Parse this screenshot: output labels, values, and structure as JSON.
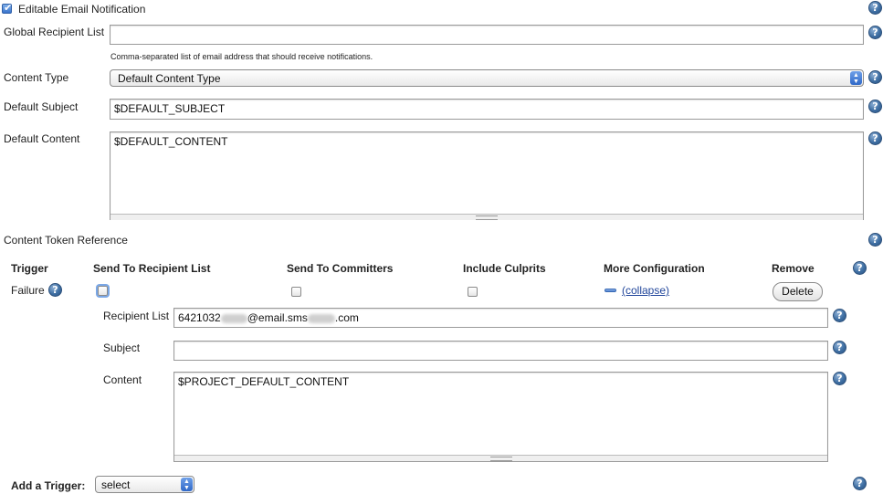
{
  "editable": {
    "checkbox_label": "Editable Email Notification",
    "checked": true
  },
  "global_recipients": {
    "label": "Global Recipient List",
    "value": "",
    "hint": "Comma-separated list of email address that should receive notifications."
  },
  "content_type": {
    "label": "Content Type",
    "selected": "Default Content Type"
  },
  "default_subject": {
    "label": "Default Subject",
    "value": "$DEFAULT_SUBJECT"
  },
  "default_content": {
    "label": "Default Content",
    "value": "$DEFAULT_CONTENT"
  },
  "token_reference": {
    "label": "Content Token Reference"
  },
  "triggers_table": {
    "headers": {
      "trigger": "Trigger",
      "send_to_recipient_list": "Send To Recipient List",
      "send_to_committers": "Send To Committers",
      "include_culprits": "Include Culprits",
      "more_configuration": "More Configuration",
      "remove": "Remove"
    },
    "rows": [
      {
        "trigger": "Failure",
        "send_to_recipient_list": false,
        "send_to_committers": false,
        "include_culprits": false,
        "collapse_link": "(collapse)",
        "delete_label": "Delete",
        "recipient_list_label": "Recipient List",
        "recipient_list_value_prefix": "6421032",
        "recipient_list_value_mid": "@email.sms",
        "recipient_list_value_suffix": ".com",
        "subject_label": "Subject",
        "subject_value": "",
        "content_label": "Content",
        "content_value": "$PROJECT_DEFAULT_CONTENT"
      }
    ]
  },
  "add_trigger": {
    "label": "Add a Trigger:",
    "selected": "select"
  },
  "icons": {
    "help": "help-icon",
    "checkbox": "checkbox-icon",
    "select_arrows": "select-arrows-icon",
    "collapse": "collapse-icon"
  },
  "colors": {
    "link": "#20459a",
    "help_icon": "#3f6fa3",
    "checkbox_checked": "#3a74cc"
  }
}
